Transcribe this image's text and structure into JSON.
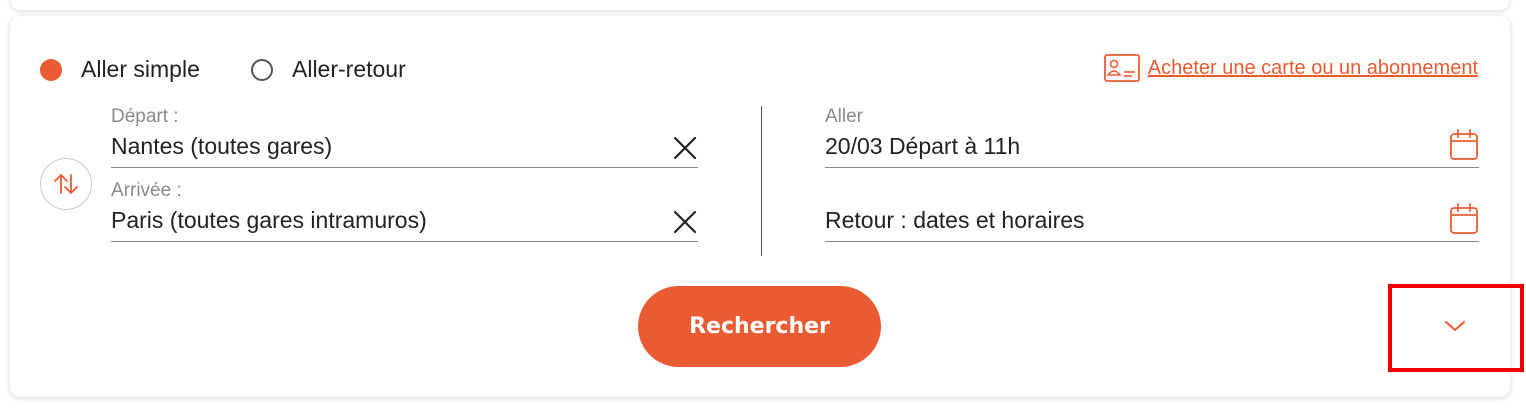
{
  "trip_type": {
    "one_way_label": "Aller simple",
    "round_trip_label": "Aller-retour",
    "selected": "one_way"
  },
  "buy_link": {
    "label": "Acheter une carte ou un abonnement",
    "icon": "id-card-icon"
  },
  "departure": {
    "label": "Départ :",
    "value": "Nantes (toutes gares)",
    "clear_icon": "close-icon"
  },
  "arrival": {
    "label": "Arrivée :",
    "value": "Paris (toutes gares intramuros)",
    "clear_icon": "close-icon"
  },
  "swap": {
    "icon": "swap-vertical-icon"
  },
  "outbound": {
    "label": "Aller",
    "value": "20/03 Départ à 11h",
    "icon": "calendar-icon"
  },
  "return": {
    "label": "",
    "value": "Retour : dates et horaires",
    "icon": "calendar-icon"
  },
  "search_button": {
    "label": "Rechercher"
  },
  "expand": {
    "icon": "chevron-down-icon"
  },
  "colors": {
    "accent": "#e85b33",
    "text": "#222222",
    "muted": "#8a8a8a",
    "highlight": "#ee0000"
  }
}
